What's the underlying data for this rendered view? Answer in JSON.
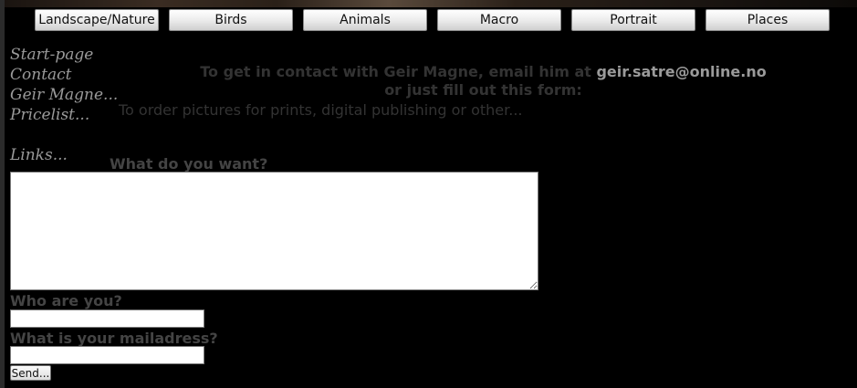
{
  "nav": {
    "items": [
      {
        "label": "Landscape/Nature"
      },
      {
        "label": "Birds"
      },
      {
        "label": "Animals"
      },
      {
        "label": "Macro"
      },
      {
        "label": "Portrait"
      },
      {
        "label": "Places"
      }
    ]
  },
  "sidebar": {
    "items": [
      {
        "label": "Start-page"
      },
      {
        "label": "Contact"
      },
      {
        "label": "Geir Magne..."
      },
      {
        "label": "Pricelist..."
      },
      {
        "label": "Links..."
      }
    ]
  },
  "contact": {
    "intro_prefix": "To get in contact with Geir Magne, email him at ",
    "email": "geir.satre@online.no",
    "intro_suffix": "or just fill out this form:",
    "order_note": "To order pictures for prints, digital publishing or other..."
  },
  "form": {
    "want_label": "What do you want?",
    "want_value": "",
    "who_label": "Who are you?",
    "who_value": "",
    "mail_label": "What is your mailadress?",
    "mail_value": "",
    "send_label": "Send..."
  },
  "colors": {
    "background": "#000000",
    "sidebar_text": "#9a9a9a",
    "label_text": "#444444",
    "email_highlight": "#9a9a9a"
  }
}
